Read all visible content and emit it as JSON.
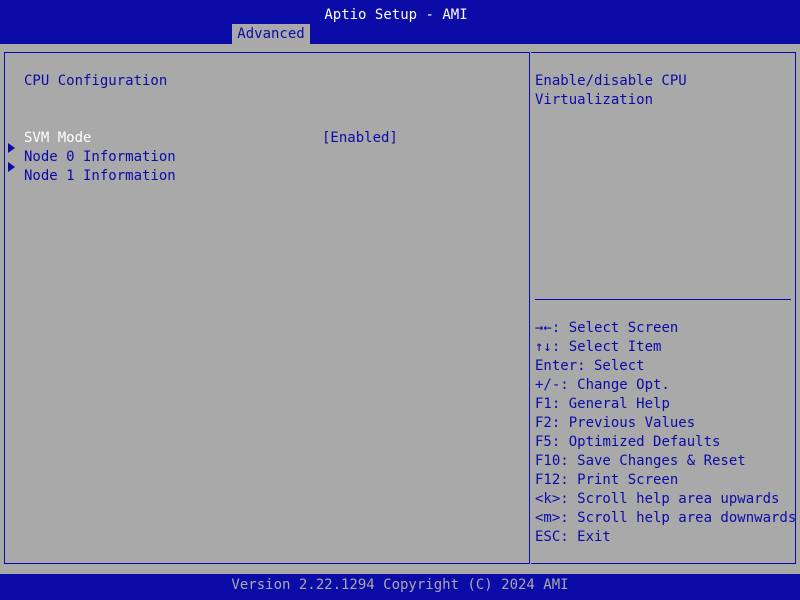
{
  "header": {
    "title": "Aptio Setup - AMI",
    "active_tab": "Advanced"
  },
  "page": {
    "section_title": "CPU Configuration",
    "items": [
      {
        "label": "SVM Mode",
        "value": "[Enabled]",
        "selected": true
      },
      {
        "label": "Node 0 Information",
        "submenu": true
      },
      {
        "label": "Node 1 Information",
        "submenu": true
      }
    ]
  },
  "help": {
    "lines": [
      "Enable/disable CPU",
      "Virtualization"
    ]
  },
  "keys": [
    {
      "key": "→←:",
      "desc": " Select Screen",
      "key_icon": "left-right-arrows"
    },
    {
      "key": "↑↓:",
      "desc": " Select Item",
      "key_icon": "up-down-arrows"
    },
    {
      "key": "Enter:",
      "desc": " Select"
    },
    {
      "key": "+/-:",
      "desc": " Change Opt."
    },
    {
      "key": "F1:",
      "desc": " General Help"
    },
    {
      "key": "F2:",
      "desc": " Previous Values"
    },
    {
      "key": "F5:",
      "desc": " Optimized Defaults"
    },
    {
      "key": "F10:",
      "desc": " Save Changes & Reset"
    },
    {
      "key": "F12:",
      "desc": " Print Screen"
    },
    {
      "key": "<k>:",
      "desc": " Scroll help area upwards"
    },
    {
      "key": "<m>:",
      "desc": " Scroll help area downwards"
    },
    {
      "key": "ESC:",
      "desc": " Exit"
    }
  ],
  "footer": {
    "text": "Version 2.22.1294 Copyright (C) 2024 AMI"
  },
  "colors": {
    "bios_blue": "#0b0ba8",
    "bios_gray": "#a9a9a9",
    "highlight_white": "#ffffff"
  }
}
